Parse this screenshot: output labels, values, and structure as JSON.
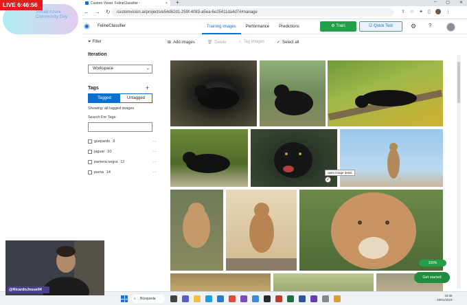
{
  "browser": {
    "tab_title": "Custom Vision: FelineClassifier -",
    "new_tab": "+",
    "url": "customvision.ai/projects/e54d62d1-259f-4083-a5ea-6e25411da4d7#/manage"
  },
  "header": {
    "project_name": "FelineClassifier",
    "tabs": [
      {
        "label": "Training Images",
        "active": true
      },
      {
        "label": "Performance",
        "active": false
      },
      {
        "label": "Predictions",
        "active": false
      }
    ],
    "train_label": "Train",
    "quick_test_label": "Quick Test"
  },
  "sidebar": {
    "filter_label": "Filter",
    "iteration_heading": "Iteration",
    "iteration_value": "Workspace",
    "tags_heading": "Tags",
    "tagged_label": "Tagged",
    "untagged_label": "Untagged",
    "showing_text": "Showing: all tagged images",
    "search_label": "Search For Tags:",
    "tags": [
      {
        "name": "guepardo",
        "count": "9"
      },
      {
        "name": "jaguar",
        "count": "10"
      },
      {
        "name": "pantera negra",
        "count": "12"
      },
      {
        "name": "puma",
        "count": "14"
      }
    ]
  },
  "toolbar": {
    "add_images": "Add images",
    "delete": "Delete",
    "tag_images": "Tag images",
    "select_all": "Select all"
  },
  "grid": {
    "tooltip": "open image detail"
  },
  "status": {
    "progress": "100%",
    "get_started": "Get started"
  },
  "taskbar": {
    "search_label": "Búsqueda",
    "time": "18:38",
    "date": "18/01/2023"
  },
  "overlay": {
    "live_badge": "LIVE 6:46:56",
    "event_logo_text": "Virtual Azure Community Day",
    "presenter_handle": "@RicardoJosue04"
  },
  "colors": {
    "accent": "#0b6fcc",
    "train_green": "#22a049",
    "live_red": "#e21b1b"
  }
}
